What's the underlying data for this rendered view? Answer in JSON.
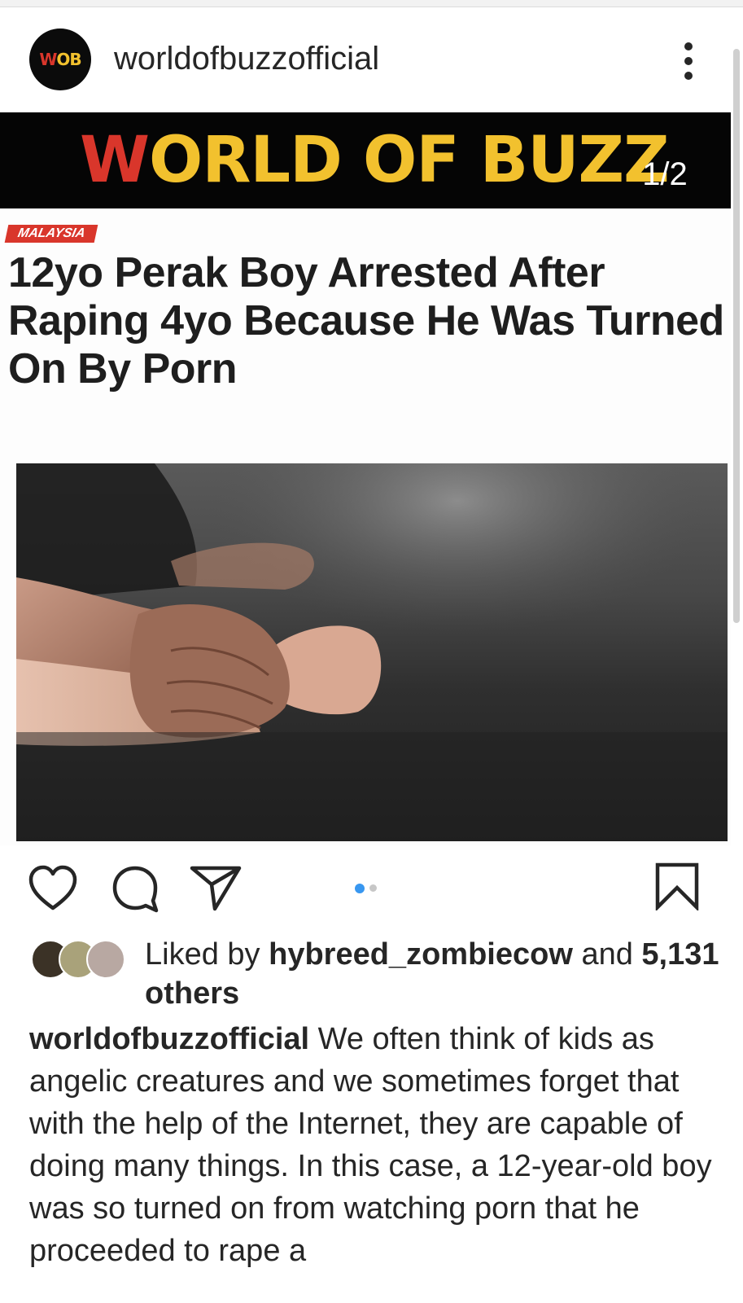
{
  "post": {
    "username": "worldofbuzzofficial",
    "avatar_text_w": "W",
    "avatar_text_ob": "OB",
    "menu_icon": "more-vertical-icon"
  },
  "media": {
    "banner_w": "W",
    "banner_rest": "ORLD OF BUZZ",
    "page_indicator": "1/2",
    "category": "MALAYSIA",
    "headline": "12yo Perak Boy Arrested After Raping 4yo Because He Was Turned On By Porn",
    "carousel_active": 1,
    "carousel_count": 2
  },
  "actions": {
    "like_icon": "heart-icon",
    "comment_icon": "comment-icon",
    "share_icon": "send-icon",
    "save_icon": "bookmark-icon"
  },
  "likes": {
    "prefix": "Liked by",
    "user": "hybreed_zombiecow",
    "and": "and",
    "others": "5,131 others"
  },
  "caption": {
    "username": "worldofbuzzofficial",
    "text": "We often think of kids as angelic creatures and we sometimes forget that with the help of the Internet, they are capable of doing many things. In this case, a 12-year-old boy was so turned on from watching porn that he proceeded to rape a"
  },
  "colors": {
    "brand_red": "#d9362b",
    "brand_yellow": "#f2c12e",
    "carousel_active": "#3897f0",
    "carousel_inactive": "#c7c7c7"
  }
}
